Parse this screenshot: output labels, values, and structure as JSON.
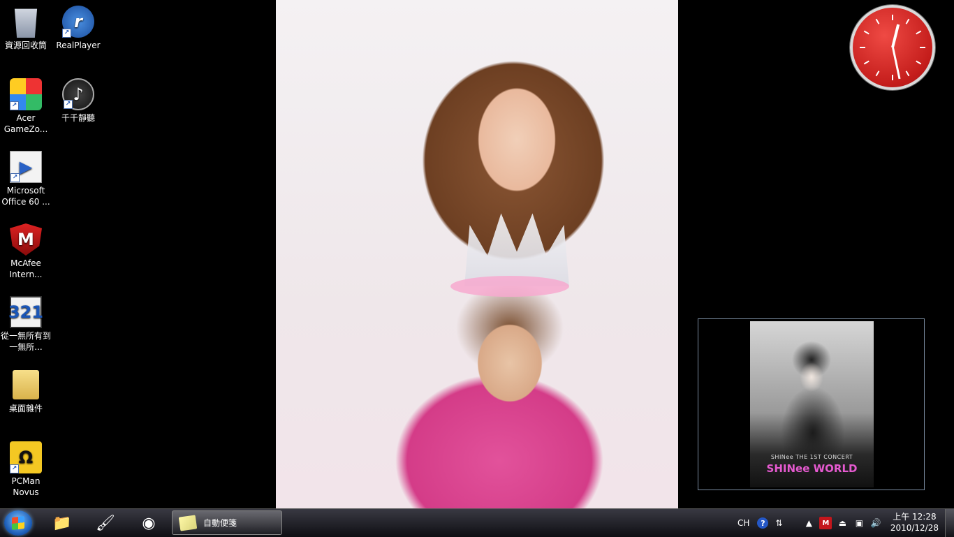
{
  "desktop_icons": [
    {
      "label": "資源回收筒",
      "icon": "recycle-bin-icon",
      "shortcut": false
    },
    {
      "label": "RealPlayer",
      "icon": "realplayer-icon",
      "shortcut": true,
      "glyph": "r"
    },
    {
      "label": "Acer GameZo...",
      "icon": "acer-gamezone-icon",
      "shortcut": true
    },
    {
      "label": "千千靜聽",
      "icon": "ttplayer-icon",
      "shortcut": true,
      "glyph": "♪"
    },
    {
      "label": "Microsoft Office 60 ...",
      "icon": "microsoft-office-icon",
      "shortcut": true
    },
    {
      "label": "McAfee Intern...",
      "icon": "mcafee-icon",
      "shortcut": true,
      "glyph": "M"
    },
    {
      "label": "從一無所有到一無所...",
      "icon": "video-file-icon",
      "shortcut": false,
      "glyph": "321"
    },
    {
      "label": "桌面雜件",
      "icon": "folder-icon",
      "shortcut": false
    },
    {
      "label": "PCMan Novus",
      "icon": "pcman-icon",
      "shortcut": true,
      "glyph": "Ω"
    }
  ],
  "slideshow": {
    "caption": "SHINee THE 1ST CONCERT",
    "logo": "SHINee WORLD"
  },
  "taskbar": {
    "pinned": [
      {
        "name": "explorer-icon",
        "glyph": "📁"
      },
      {
        "name": "paint-icon",
        "glyph": "🖌"
      },
      {
        "name": "media-player-icon",
        "glyph": "◉"
      }
    ],
    "active_window": "自動便箋",
    "tray": {
      "language": "CH",
      "help": "?",
      "time": "上午 12:28",
      "date": "2010/12/28"
    }
  },
  "clock": {
    "hour": 12,
    "minute": 28,
    "second": 0
  }
}
